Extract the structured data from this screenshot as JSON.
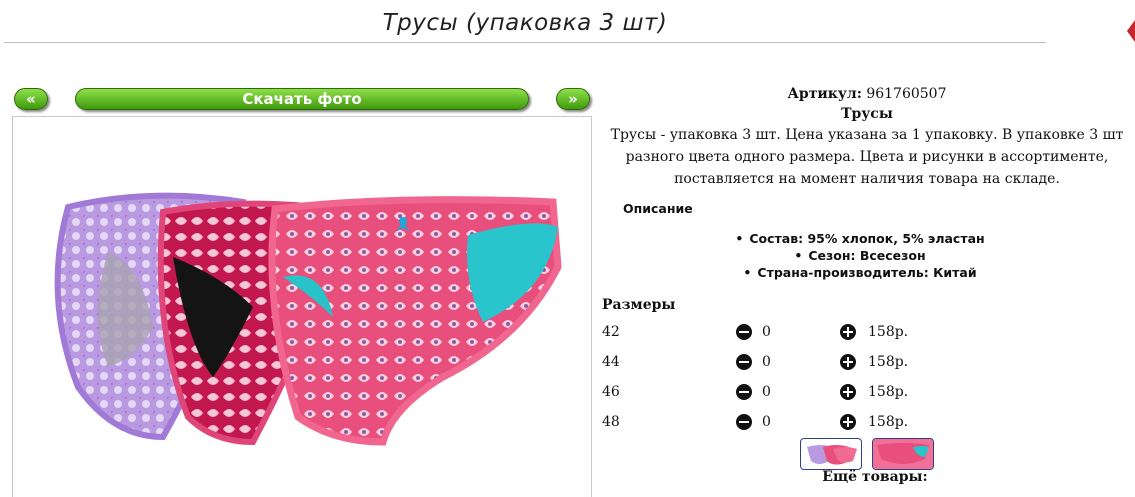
{
  "page": {
    "title": "Трусы (упаковка 3 шт)"
  },
  "gallery": {
    "prev_label": "«",
    "next_label": "»",
    "download_label": "Скачать фото"
  },
  "product": {
    "article_label": "Артикул:",
    "article_value": "961760507",
    "name": "Трусы",
    "description": "Трусы - упаковка 3 шт. Цена указана за 1 упаковку. В упаковке 3 шт разного цвета одного размера. Цвета и рисунки в ассортименте, поставляется на момент наличия товара на складе.",
    "description_heading": "Описание",
    "specs": [
      "Состав: 95% хлопок, 5% эластан",
      "Сезон: Всесезон",
      "Страна-производитель: Китай"
    ]
  },
  "sizes": {
    "heading": "Размеры",
    "rows": [
      {
        "size": "42",
        "qty": "0",
        "price": "158р."
      },
      {
        "size": "44",
        "qty": "0",
        "price": "158р."
      },
      {
        "size": "46",
        "qty": "0",
        "price": "158р."
      },
      {
        "size": "48",
        "qty": "0",
        "price": "158р."
      }
    ]
  },
  "more_label": "Ещё товары:",
  "icons": {
    "minus": "minus-circle-icon",
    "plus": "plus-circle-icon"
  },
  "colors": {
    "button_green": "#4caf18",
    "title_rule": "#bdbdbd",
    "thumb_border": "#2f3f88"
  }
}
